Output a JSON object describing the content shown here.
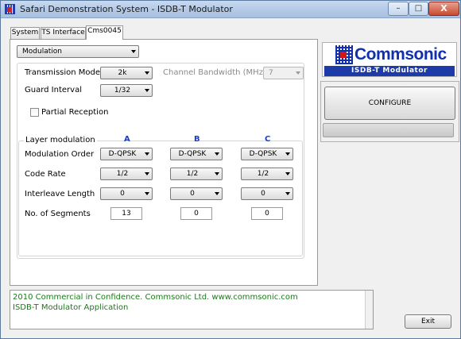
{
  "window": {
    "title": "Safari Demonstration System - ISDB-T Modulator",
    "close_glyph": "X",
    "min_glyph": "–",
    "max_glyph": "□"
  },
  "tabs": [
    {
      "label": "System"
    },
    {
      "label": "TS Interface"
    },
    {
      "label": "Cms0045",
      "active": true
    }
  ],
  "view_select": {
    "value": "Modulation"
  },
  "transmission_mode": {
    "label": "Transmission Mode",
    "value": "2k"
  },
  "channel_bandwidth": {
    "label": "Channel Bandwidth (MHz)",
    "value": "7"
  },
  "guard_interval": {
    "label": "Guard Interval",
    "value": "1/32"
  },
  "partial_reception": {
    "label": "Partial Reception",
    "checked": false
  },
  "layer_modulation": {
    "title": "Layer modulation",
    "columns": [
      "A",
      "B",
      "C"
    ],
    "rows": {
      "modulation_order": {
        "label": "Modulation Order",
        "values": [
          "D-QPSK",
          "D-QPSK",
          "D-QPSK"
        ]
      },
      "code_rate": {
        "label": "Code Rate",
        "values": [
          "1/2",
          "1/2",
          "1/2"
        ]
      },
      "interleave_length": {
        "label": "Interleave Length",
        "values": [
          "0",
          "0",
          "0"
        ]
      },
      "segments": {
        "label": "No. of Segments",
        "values": [
          "13",
          "0",
          "0"
        ]
      }
    }
  },
  "logo": {
    "name": "Commsonic",
    "subtitle": "ISDB-T Modulator"
  },
  "configure_button": {
    "label": "CONFIGURE"
  },
  "progress": {
    "fraction": 0
  },
  "log": [
    "2010 Commercial in Confidence. Commsonic Ltd.     www.commsonic.com",
    "ISDB-T Modulator Application"
  ],
  "exit_button": {
    "label": "Exit"
  },
  "colors": {
    "logo_blue": "#1030b0",
    "logo_red": "#d01818",
    "log_text": "#1a7a1a",
    "column_head": "#1a3ec8"
  }
}
